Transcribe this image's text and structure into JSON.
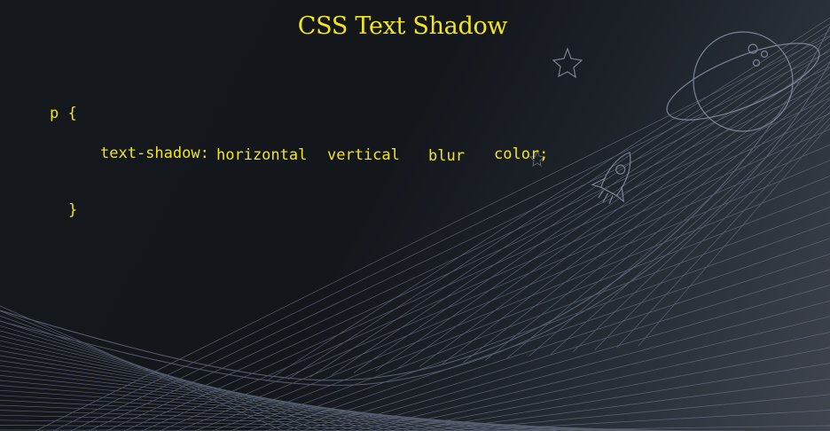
{
  "title": "CSS Text Shadow",
  "code": {
    "selector_line": "p {",
    "property": "text-shadow:",
    "value_horizontal": "horizontal",
    "value_vertical": "vertical",
    "value_blur": "blur",
    "value_color": "color;",
    "closing_brace": "}"
  },
  "colors": {
    "text": "#f2e51e",
    "background_dark": "#13171c",
    "background_light": "#40454f",
    "line_art": "#6b7488"
  },
  "icons": [
    "planet-icon",
    "star-icon",
    "rocket-icon",
    "string-art-curves"
  ]
}
